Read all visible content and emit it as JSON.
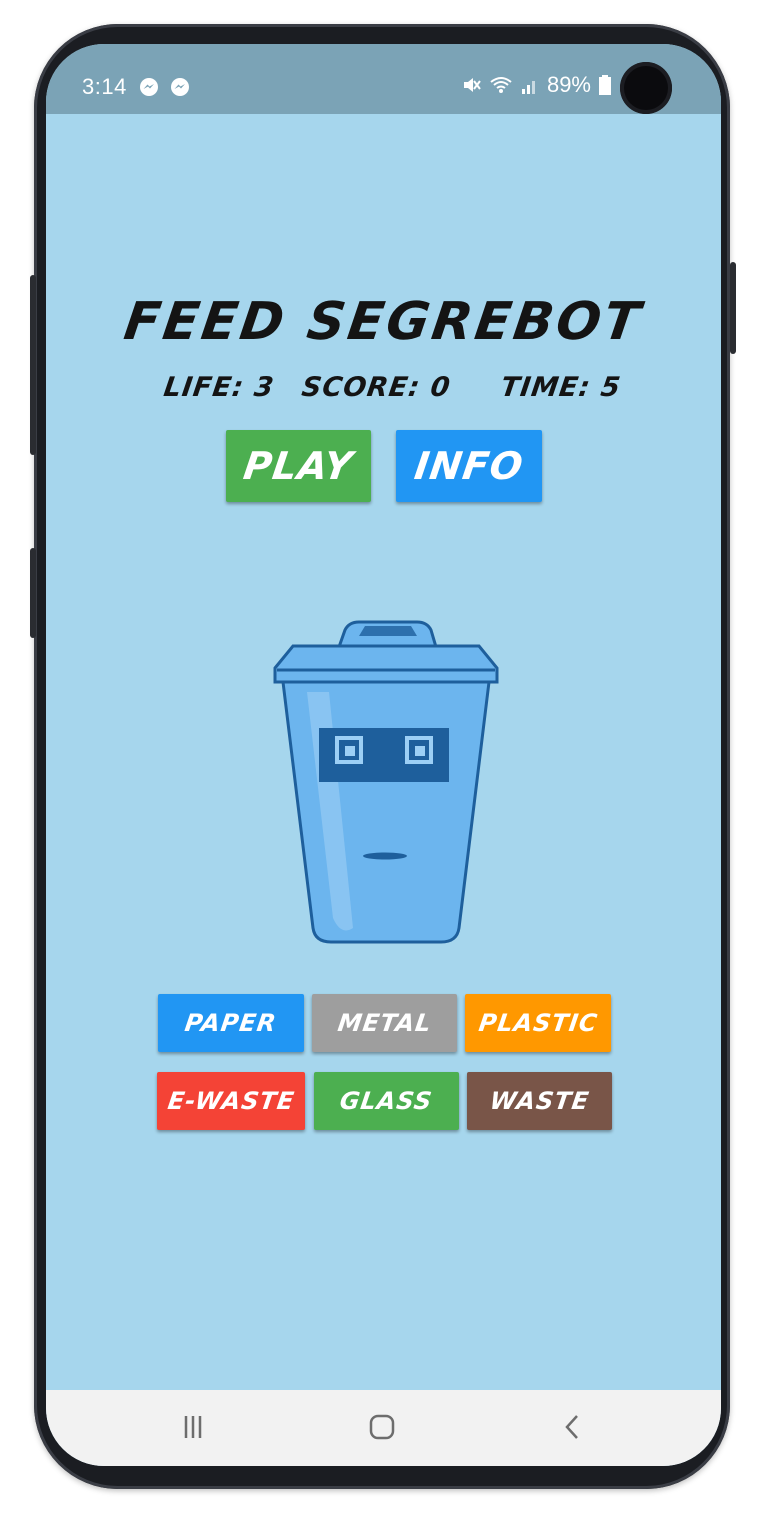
{
  "status_bar": {
    "time": "3:14",
    "notification_icons": [
      "messenger-icon",
      "messenger-icon"
    ],
    "status_icons": [
      "mute-icon",
      "wifi-icon",
      "signal-icon",
      "battery-icon"
    ],
    "battery": "89%"
  },
  "game": {
    "title": "FEED SEGREBOT",
    "life_label": "LIFE: 3",
    "score_label": "SCORE: 0",
    "time_label": "TIME: 5",
    "play_label": "PLAY",
    "info_label": "INFO"
  },
  "categories": [
    {
      "label": "PAPER",
      "color": "#2196f3"
    },
    {
      "label": "METAL",
      "color": "#9e9e9e"
    },
    {
      "label": "PLASTIC",
      "color": "#ff9800"
    },
    {
      "label": "E-WASTE",
      "color": "#f44336"
    },
    {
      "label": "GLASS",
      "color": "#4caf50"
    },
    {
      "label": "WASTE",
      "color": "#795548"
    }
  ],
  "colors": {
    "play": "#4caf50",
    "info": "#2196f3",
    "background": "#a6d6ed",
    "robot_body": "#6cb5ee",
    "robot_visor": "#1e5f9c"
  },
  "nav_bar": {
    "icons": [
      "recent-apps-icon",
      "home-icon",
      "back-icon"
    ]
  }
}
